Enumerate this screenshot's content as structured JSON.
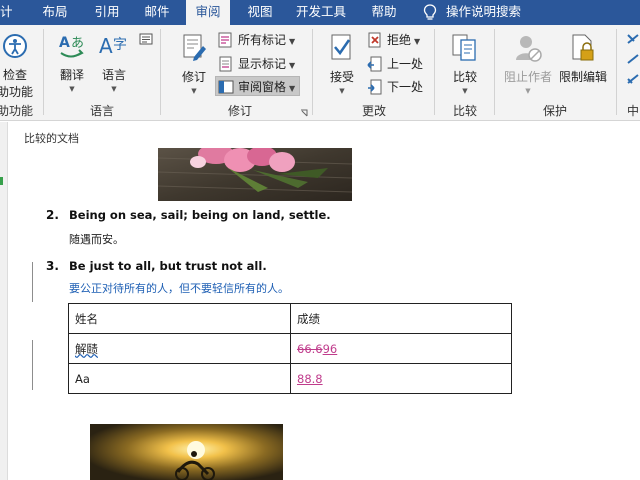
{
  "tabs": [
    {
      "label": "计"
    },
    {
      "label": "布局"
    },
    {
      "label": "引用"
    },
    {
      "label": "邮件"
    },
    {
      "label": "审阅",
      "active": true
    },
    {
      "label": "视图"
    },
    {
      "label": "开发工具"
    },
    {
      "label": "帮助"
    }
  ],
  "tell_me": "操作说明搜索",
  "ribbon": {
    "proofing": {
      "btn_line1": "检查",
      "btn_line2": "助功能",
      "group": "助功能"
    },
    "language": {
      "translate": "翻译",
      "language": "语言",
      "group": "语言"
    },
    "tracking": {
      "track_changes": "修订",
      "markup_select": "所有标记",
      "show_markup": "显示标记",
      "reviewing_pane": "审阅窗格",
      "group": "修订"
    },
    "changes": {
      "accept": "接受",
      "reject": "拒绝",
      "previous": "上一处",
      "next": "下一处",
      "group": "更改"
    },
    "compare": {
      "compare": "比较",
      "group": "比较"
    },
    "protect": {
      "block_authors": "阻止作者",
      "restrict_editing": "限制编辑",
      "group": "保护"
    },
    "ink": {
      "group": "中"
    }
  },
  "document": {
    "pane_title": "比较的文档",
    "items": [
      {
        "num": "2.",
        "english": "Being on sea, sail; being on land, settle.",
        "chinese": "随遇而安。"
      },
      {
        "num": "3.",
        "english": "Be just to all, but trust not all.",
        "chinese": "要公正对待所有的人，但不要轻信所有的人。"
      }
    ],
    "table": {
      "headers": [
        "姓名",
        "成绩"
      ],
      "rows": [
        {
          "name": "解赜",
          "score_deleted": "66.6",
          "score_inserted": "96"
        },
        {
          "name": "Aa",
          "score_deleted": "",
          "score_inserted": "88.8"
        }
      ]
    }
  },
  "colors": {
    "tab_bar": "#2b579a",
    "ribbon_bg": "#f3f3f3",
    "revision_pink": "#c03c8c",
    "inserted_blue": "#1e5fb4"
  },
  "icons": [
    "lightbulb-icon",
    "accessibility-check-icon",
    "translate-icon",
    "language-icon",
    "track-changes-icon",
    "markup-list-icon",
    "show-markup-icon",
    "reviewing-pane-icon",
    "accept-icon",
    "reject-icon",
    "previous-change-icon",
    "next-change-icon",
    "compare-icon",
    "block-authors-icon",
    "restrict-editing-icon"
  ]
}
